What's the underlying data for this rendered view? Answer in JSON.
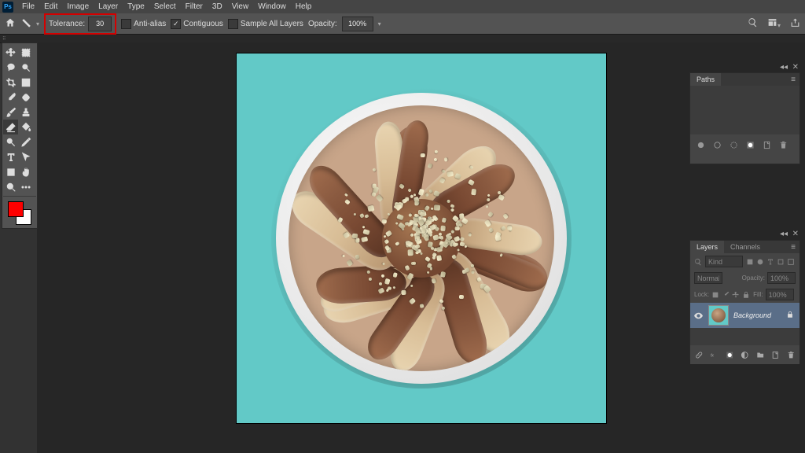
{
  "app_icon": "Ps",
  "menus": [
    "File",
    "Edit",
    "Image",
    "Layer",
    "Type",
    "Select",
    "Filter",
    "3D",
    "View",
    "Window",
    "Help"
  ],
  "options": {
    "tolerance_label": "Tolerance:",
    "tolerance_value": "30",
    "anti_alias_label": "Anti-alias",
    "anti_alias_checked": false,
    "contiguous_label": "Contiguous",
    "contiguous_checked": true,
    "sample_all_label": "Sample All Layers",
    "sample_all_checked": false,
    "opacity_label": "Opacity:",
    "opacity_value": "100%"
  },
  "swatches": {
    "fg": "#ff0000",
    "bg": "#ffffff"
  },
  "paths_panel": {
    "title": "Paths"
  },
  "layers_panel": {
    "tabs": [
      "Layers",
      "Channels"
    ],
    "search_placeholder": "Kind",
    "blend_mode": "Normal",
    "opacity_label": "Opacity:",
    "opacity_value": "100%",
    "lock_label": "Lock:",
    "fill_label": "Fill:",
    "fill_value": "100%",
    "layer_name": "Background"
  }
}
